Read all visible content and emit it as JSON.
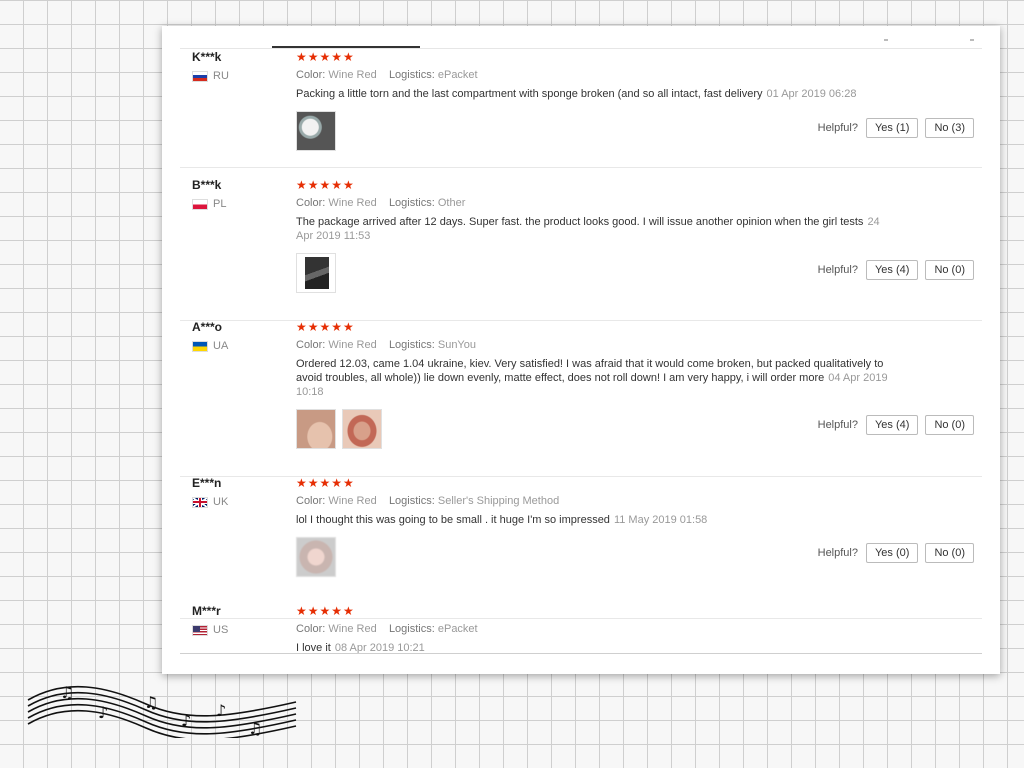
{
  "helpful_label": "Helpful?",
  "rating_stars": "★★★★★",
  "reviews": [
    {
      "name": "K***k",
      "country": "RU",
      "color_key": "Color:",
      "color": "Wine Red",
      "logistics_key": "Logistics:",
      "logistics": "ePacket",
      "text": "Packing a little torn and the last compartment with sponge broken (and so all intact, fast delivery",
      "date": "01 Apr 2019 06:28",
      "yes": "Yes (1)",
      "no": "No (3)"
    },
    {
      "name": "B***k",
      "country": "PL",
      "color_key": "Color:",
      "color": "Wine Red",
      "logistics_key": "Logistics:",
      "logistics": "Other",
      "text": "The package arrived after 12 days. Super fast. the product looks good. I will issue another opinion when the girl tests",
      "date": "24 Apr 2019 11:53",
      "yes": "Yes (4)",
      "no": "No (0)"
    },
    {
      "name": "A***o",
      "country": "UA",
      "color_key": "Color:",
      "color": "Wine Red",
      "logistics_key": "Logistics:",
      "logistics": "SunYou",
      "text": "Ordered 12.03, came 1.04 ukraine, kiev. Very satisfied! I was afraid that it would come broken, but packed qualitatively to avoid troubles, all whole)) lie down evenly, matte effect, does not roll down! I am very happy, i will order more",
      "date": "04 Apr 2019 10:18",
      "yes": "Yes (4)",
      "no": "No (0)"
    },
    {
      "name": "E***n",
      "country": "UK",
      "color_key": "Color:",
      "color": "Wine Red",
      "logistics_key": "Logistics:",
      "logistics": "Seller's Shipping Method",
      "text": "lol I thought this was going to be small . it huge I'm so impressed",
      "date": "11 May 2019 01:58",
      "yes": "Yes (0)",
      "no": "No (0)"
    },
    {
      "name": "M***r",
      "country": "US",
      "color_key": "Color:",
      "color": "Wine Red",
      "logistics_key": "Logistics:",
      "logistics": "ePacket",
      "text": "I love it",
      "date": "08 Apr 2019 10:21"
    }
  ]
}
